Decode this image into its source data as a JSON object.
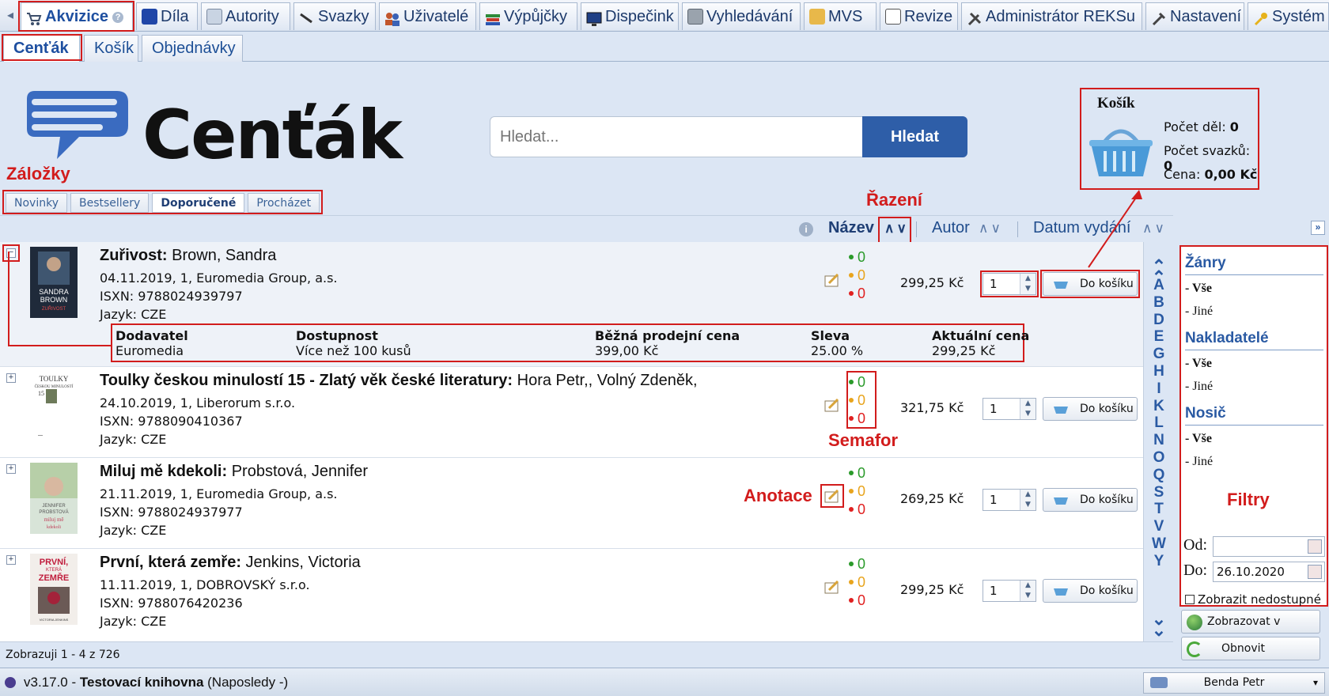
{
  "top_menu": [
    {
      "label": "Akvizice",
      "icon": "cart-icon",
      "active": true
    },
    {
      "label": "Díla",
      "icon": "book-icon"
    },
    {
      "label": "Autority",
      "icon": "card-icon"
    },
    {
      "label": "Svazky",
      "icon": "pen-icon"
    },
    {
      "label": "Uživatelé",
      "icon": "users-icon"
    },
    {
      "label": "Výpůjčky",
      "icon": "books-icon"
    },
    {
      "label": "Dispečink",
      "icon": "monitor-icon"
    },
    {
      "label": "Vyhledávání",
      "icon": "search-icon"
    },
    {
      "label": "MVS",
      "icon": "package-icon"
    },
    {
      "label": "Revize",
      "icon": "document-icon"
    },
    {
      "label": "Administrátor REKSu",
      "icon": "tools-icon"
    },
    {
      "label": "Nastavení",
      "icon": "wrench-icon"
    },
    {
      "label": "Systém",
      "icon": "key-icon"
    }
  ],
  "sub_tabs": [
    "Cenťák",
    "Košík",
    "Objednávky"
  ],
  "header": {
    "logo_text": "Cenťák",
    "search_placeholder": "Hledat...",
    "search_button": "Hledat"
  },
  "bookmark_tabs": [
    "Novinky",
    "Bestsellery",
    "Doporučené",
    "Procházet"
  ],
  "basket": {
    "title": "Košík",
    "works_label": "Počet děl:",
    "works_value": "0",
    "volumes_label": "Počet svazků:",
    "volumes_value": "0",
    "price_label": "Cena:",
    "price_value": "0,00 Kč"
  },
  "sort": {
    "items": [
      "Název",
      "Autor",
      "Datum vydání"
    ],
    "up": "∧",
    "down": "∨"
  },
  "books": [
    {
      "title": "Zuřivost:",
      "author": "Brown, Sandra",
      "published": "04.11.2019, 1, Euromedia Group, a.s.",
      "isxn": "ISXN: 9788024939797",
      "language": "Jazyk: CZE",
      "green": "0",
      "orange": "0",
      "red": "0",
      "price": "299,25 Kč",
      "qty": "1",
      "cart_label": "Do košíku",
      "expanded": true
    },
    {
      "title": "Toulky českou minulostí 15 - Zlatý věk české literatury:",
      "author": "Hora Petr,, Volný Zdeněk,",
      "published": "24.10.2019, 1, Liberorum s.r.o.",
      "isxn": "ISXN: 9788090410367",
      "language": "Jazyk: CZE",
      "green": "0",
      "orange": "0",
      "red": "0",
      "price": "321,75 Kč",
      "qty": "1",
      "cart_label": "Do košíku"
    },
    {
      "title": "Miluj mě kdekoli:",
      "author": "Probstová, Jennifer",
      "published": "21.11.2019, 1, Euromedia Group, a.s.",
      "isxn": "ISXN: 9788024937977",
      "language": "Jazyk: CZE",
      "green": "0",
      "orange": "0",
      "red": "0",
      "price": "269,25 Kč",
      "qty": "1",
      "cart_label": "Do košíku"
    },
    {
      "title": "První, která zemře:",
      "author": "Jenkins, Victoria",
      "published": "11.11.2019, 1, DOBROVSKÝ s.r.o.",
      "isxn": "ISXN: 9788076420236",
      "language": "Jazyk: CZE",
      "green": "0",
      "orange": "0",
      "red": "0",
      "price": "299,25 Kč",
      "qty": "1",
      "cart_label": "Do košíku"
    }
  ],
  "covers": {
    "book1": [
      "SANDRA",
      "BROWN",
      "ZUŘIVOST"
    ],
    "book2": [
      "TOULKY",
      "ČESKOU MINULOSTÍ",
      "15"
    ],
    "book3": [
      "JENNIFER",
      "PROBSTOVÁ",
      "miluj mě",
      "kdekoli"
    ],
    "book4": [
      "PRVNÍ,",
      "KTERÁ",
      "ZEMŘE",
      "VICTORIA JENKINS"
    ]
  },
  "detail": {
    "supplier_h": "Dodavatel",
    "supplier_v": "Euromedia",
    "avail_h": "Dostupnost",
    "avail_v": "Více než 100 kusů",
    "regular_h": "Běžná prodejní cena",
    "regular_v": "399,00 Kč",
    "discount_h": "Sleva",
    "discount_v": "25.00 %",
    "current_h": "Aktuální cena",
    "current_v": "299,25 Kč"
  },
  "alphabet": [
    "A",
    "B",
    "D",
    "E",
    "G",
    "H",
    "I",
    "K",
    "L",
    "N",
    "O",
    "Q",
    "S",
    "T",
    "V",
    "W",
    "Y"
  ],
  "filters": {
    "genres_h": "Žánry",
    "genres": [
      "- Vše",
      "- Jiné"
    ],
    "publishers_h": "Nakladatelé",
    "publishers": [
      "- Vše",
      "- Jiné"
    ],
    "carrier_h": "Nosič",
    "carriers": [
      "- Vše",
      "- Jiné"
    ],
    "from_label": "Od:",
    "from_value": "",
    "to_label": "Do:",
    "to_value": "26.10.2020",
    "show_unavailable": "Zobrazit nedostupné"
  },
  "side_buttons": {
    "catalog": "Zobrazovat v katalogu",
    "refresh": "Obnovit"
  },
  "pager": "Zobrazuji 1 - 4 z 726",
  "status": {
    "version": "v3.17.0 -",
    "library": "Testovací knihovna",
    "last": "(Naposledy -)",
    "user": "Benda Petr"
  },
  "annotations": {
    "zalozky": "Záložky",
    "razeni": "Řazení",
    "semafor": "Semafor",
    "anotace": "Anotace",
    "filtry": "Filtry"
  },
  "colors": {
    "accent": "#2e5ea8",
    "annotation_red": "#d21c1c",
    "green": "#2a9a2a",
    "orange": "#e8a41c",
    "red": "#e02020"
  }
}
